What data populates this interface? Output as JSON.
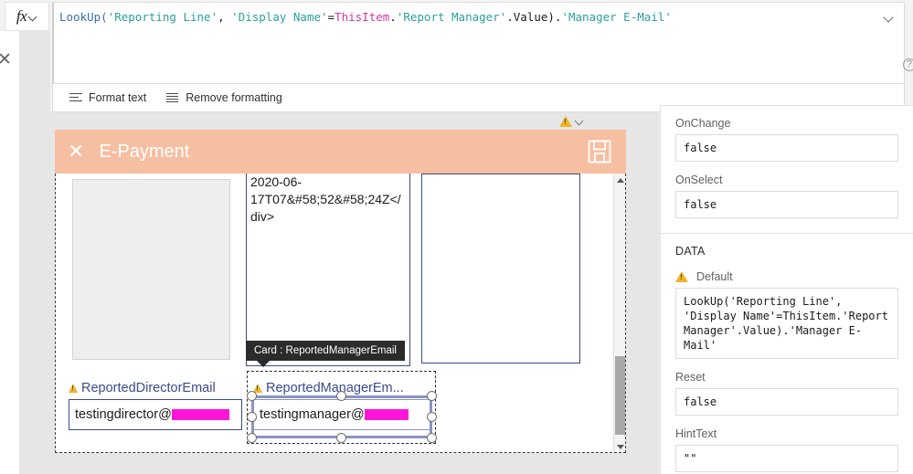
{
  "formula_bar": {
    "fx_label": "fx",
    "fx_chevron": "chevron-down-icon",
    "collapse_icon": "chevron-down-icon",
    "help_icon": "help-circle-icon",
    "expression_raw": "LookUp('Reporting Line', 'Display Name'=ThisItem.'Report Manager'.Value).'Manager E-Mail'",
    "tokens": {
      "fn": "LookUp(",
      "str1": "'Reporting Line'",
      "sep1": ", ",
      "str2": "'Display Name'",
      "eq": "=",
      "thisitem": "ThisItem",
      "dot1": ".",
      "str3": "'Report Manager'",
      "dot2": ".Value)",
      "dot3": ".",
      "str4": "'Manager E-Mail'"
    },
    "toolbar": {
      "format_text": "Format text",
      "format_text_icon": "format-text-icon",
      "remove_formatting": "Remove formatting",
      "remove_formatting_icon": "remove-formatting-icon"
    }
  },
  "left_rail": {
    "close_icon": "close-icon"
  },
  "canvas": {
    "warning_icon": "warning-triangle-icon",
    "warning_chevron": "chevron-down-icon",
    "app_header": {
      "close_icon": "close-icon",
      "title": "E-Payment",
      "save_icon": "save-floppy-icon",
      "background_color": "#F6BFA1"
    },
    "cards": [
      {
        "name": "empty-gray-card",
        "text": ""
      },
      {
        "name": "datetime-card",
        "text": "2020-06-17T07&#58;52&#58;24Z</div>"
      },
      {
        "name": "empty-card-right",
        "text": ""
      }
    ],
    "tooltip": "Card : ReportedManagerEmail",
    "fields": [
      {
        "label": "ReportedDirectorEmail",
        "warning_icon": "warning-triangle-icon",
        "value_visible": "testingdirector@",
        "value_redacted": true,
        "selected": false
      },
      {
        "label": "ReportedManagerEm...",
        "warning_icon": "warning-triangle-icon",
        "value_visible": "testingmanager@",
        "value_redacted": true,
        "selected": true
      }
    ],
    "scrollbar": {
      "up_arrow": "scroll-up-arrow-icon",
      "down_arrow": "scroll-down-arrow-icon"
    },
    "redaction_color": "#FF16D8"
  },
  "properties_pane": {
    "props": [
      {
        "label": "OnChange",
        "value": "false",
        "warning": false
      },
      {
        "label": "OnSelect",
        "value": "false",
        "warning": false
      }
    ],
    "section_title": "DATA",
    "data_props": [
      {
        "label": "Default",
        "warning": true,
        "warning_icon": "warning-triangle-icon",
        "value": "LookUp('Reporting Line', 'Display Name'=ThisItem.'Report Manager'.Value).'Manager E-Mail'"
      },
      {
        "label": "Reset",
        "warning": false,
        "value": "false"
      },
      {
        "label": "HintText",
        "warning": false,
        "value": "\"\""
      }
    ]
  }
}
